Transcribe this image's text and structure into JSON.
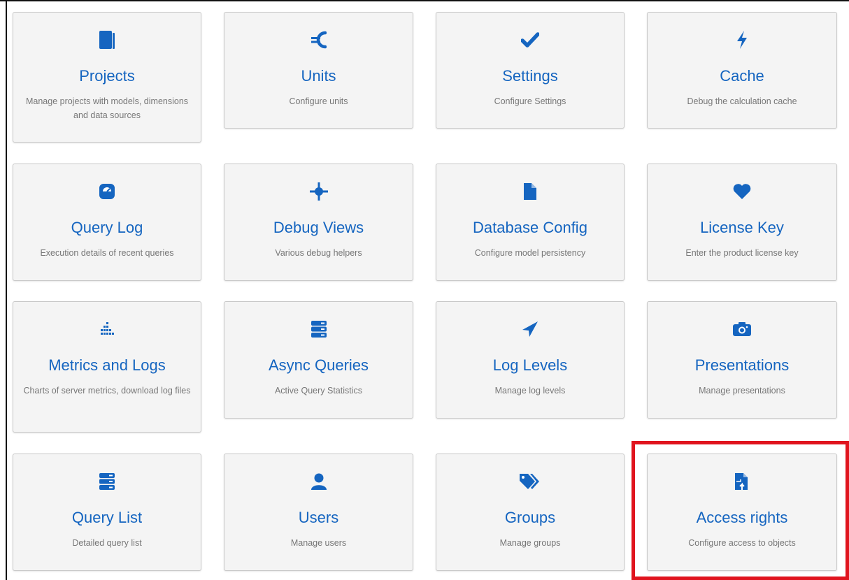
{
  "tiles": [
    {
      "title": "Projects",
      "description": "Manage projects with models, dimensions and data sources",
      "icon": "book-icon"
    },
    {
      "title": "Units",
      "description": "Configure units",
      "icon": "euro-icon"
    },
    {
      "title": "Settings",
      "description": "Configure Settings",
      "icon": "check-icon"
    },
    {
      "title": "Cache",
      "description": "Debug the calculation cache",
      "icon": "bolt-icon"
    },
    {
      "title": "Query Log",
      "description": "Execution details of recent queries",
      "icon": "dashboard-icon"
    },
    {
      "title": "Debug Views",
      "description": "Various debug helpers",
      "icon": "crosshairs-icon"
    },
    {
      "title": "Database Config",
      "description": "Configure model persistency",
      "icon": "file-icon"
    },
    {
      "title": "License Key",
      "description": "Enter the product license key",
      "icon": "heart-icon"
    },
    {
      "title": "Metrics and Logs",
      "description": "Charts of server metrics, download log files",
      "icon": "equalizer-icon"
    },
    {
      "title": "Async Queries",
      "description": "Active Query Statistics",
      "icon": "server-icon"
    },
    {
      "title": "Log Levels",
      "description": "Manage log levels",
      "icon": "paper-plane-icon"
    },
    {
      "title": "Presentations",
      "description": "Manage presentations",
      "icon": "camera-icon"
    },
    {
      "title": "Query List",
      "description": "Detailed query list",
      "icon": "server-icon"
    },
    {
      "title": "Users",
      "description": "Manage users",
      "icon": "user-icon"
    },
    {
      "title": "Groups",
      "description": "Manage groups",
      "icon": "tags-icon"
    },
    {
      "title": "Access rights",
      "description": "Configure access to objects",
      "icon": "file-share-icon"
    }
  ],
  "colors": {
    "accent": "#1565c0",
    "highlight": "#e0141e",
    "tile_bg": "#f4f4f4"
  }
}
